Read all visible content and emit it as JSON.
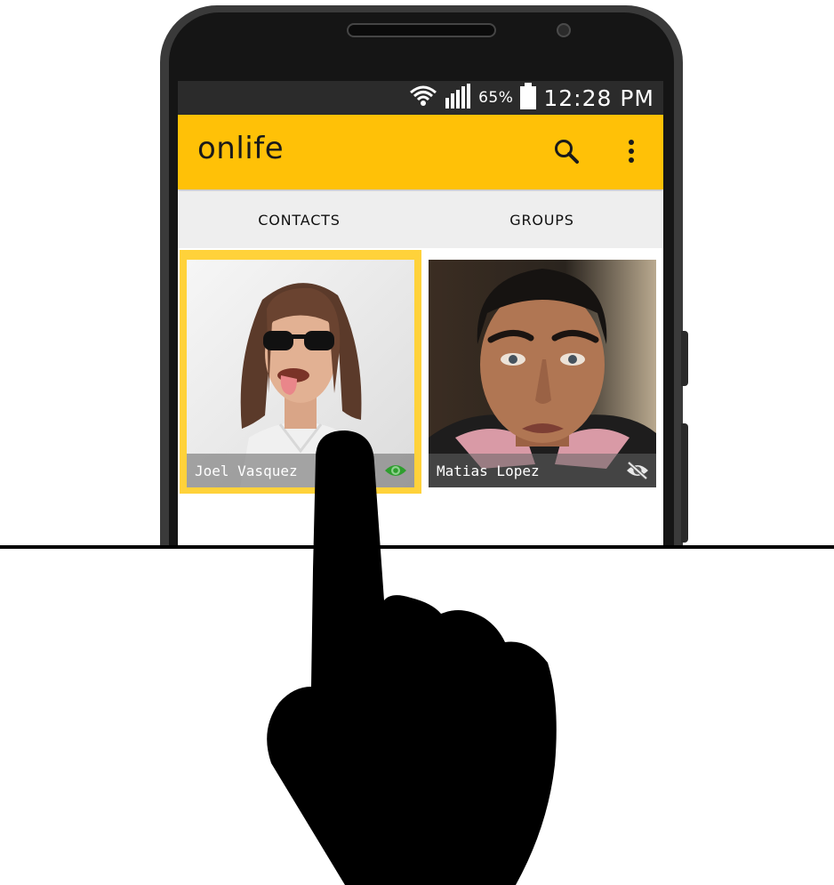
{
  "status_bar": {
    "battery_percent": "65%",
    "time": "12:28 PM",
    "icons": [
      "wifi-icon",
      "signal-icon",
      "battery-icon"
    ]
  },
  "app_bar": {
    "title": "onlife",
    "icons": [
      "search-icon",
      "overflow-menu-icon"
    ],
    "color": "#ffc107"
  },
  "tabs": [
    {
      "label": "CONTACTS"
    },
    {
      "label": "GROUPS"
    }
  ],
  "contacts": [
    {
      "name": "Joel Vasquez",
      "visibility": "visible",
      "selected": true,
      "eye_color": "#2e9e2e"
    },
    {
      "name": "Matias Lopez",
      "visibility": "hidden",
      "selected": false,
      "eye_color": "#e8e8e8"
    }
  ],
  "colors": {
    "accent": "#ffc107",
    "selection": "#ffd23a"
  }
}
